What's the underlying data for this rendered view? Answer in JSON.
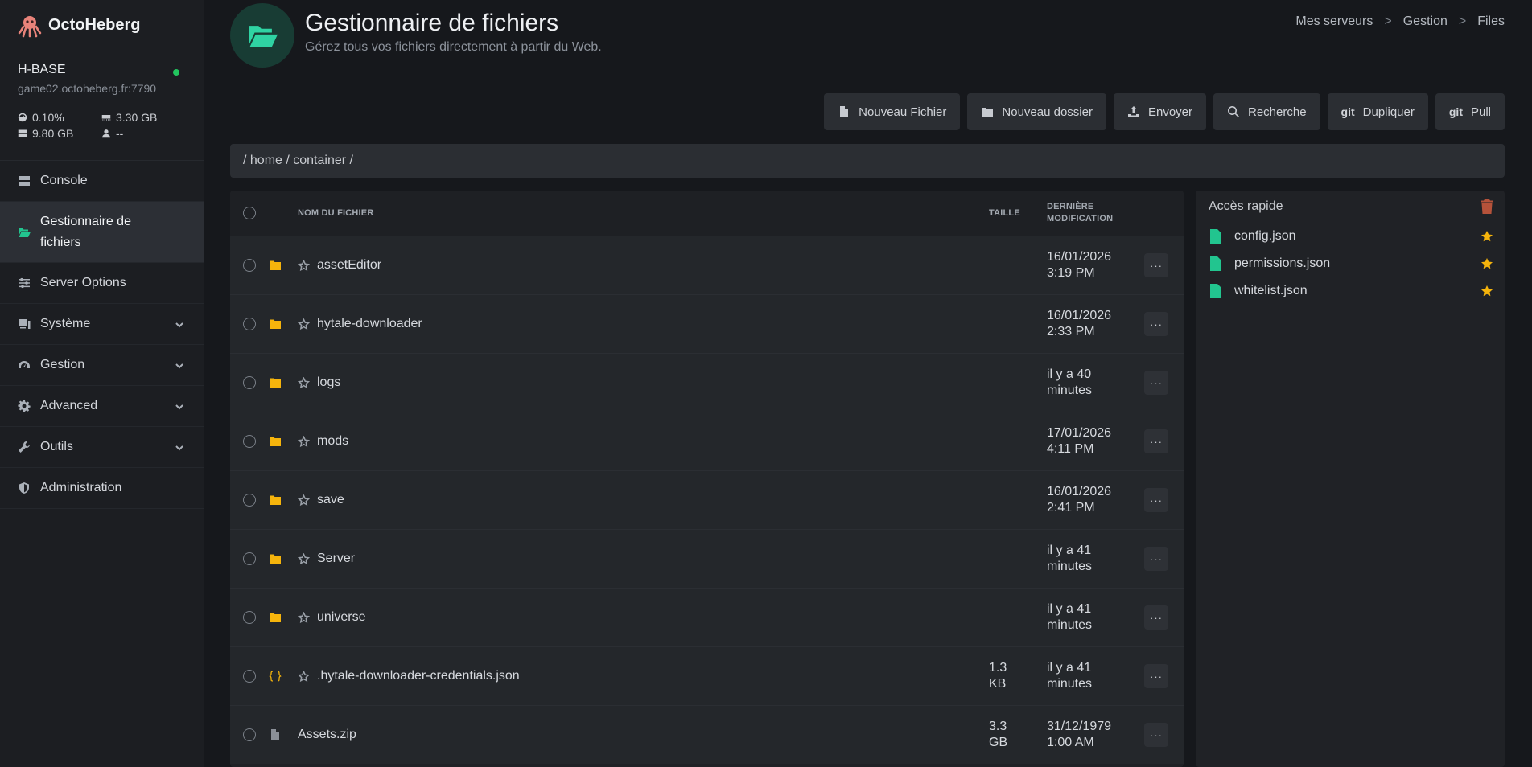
{
  "brand": {
    "name": "OctoHeberg"
  },
  "server": {
    "name": "H-BASE",
    "address": "game02.octoheberg.fr:7790",
    "cpu": "0.10%",
    "memory": "3.30 GB",
    "disk": "9.80 GB",
    "players": "--",
    "status_color": "#22c55e"
  },
  "sidebar": {
    "items": [
      {
        "label": "Console",
        "icon": "server-icon"
      },
      {
        "label": "Gestionnaire de fichiers",
        "icon": "folder-open-icon"
      },
      {
        "label": "Server Options",
        "icon": "sliders-icon"
      },
      {
        "label": "Système",
        "icon": "computer-icon"
      },
      {
        "label": "Gestion",
        "icon": "gauge-icon"
      },
      {
        "label": "Advanced",
        "icon": "gear-icon"
      },
      {
        "label": "Outils",
        "icon": "wrench-icon"
      },
      {
        "label": "Administration",
        "icon": "shield-icon"
      }
    ]
  },
  "header": {
    "title": "Gestionnaire de fichiers",
    "subtitle": "Gérez tous vos fichiers directement à partir du Web."
  },
  "breadcrumb": {
    "items": [
      "Mes serveurs",
      "Gestion",
      "Files"
    ],
    "separator": ">"
  },
  "toolbar": {
    "new_file": "Nouveau Fichier",
    "new_folder": "Nouveau dossier",
    "upload": "Envoyer",
    "search": "Recherche",
    "git_label": "git",
    "duplicate": "Dupliquer",
    "pull": "Pull"
  },
  "path": "/ home / container /",
  "table": {
    "headers": {
      "name": "NOM DU FICHIER",
      "size": "TAILLE",
      "date_line1": "DERNIÈRE",
      "date_line2": "MODIFICATION"
    },
    "more_label": "···",
    "rows": [
      {
        "name": "assetEditor",
        "type": "folder",
        "size": "",
        "size2": "",
        "date": "16/01/2026",
        "time": "3:19 PM"
      },
      {
        "name": "hytale-downloader",
        "type": "folder",
        "size": "",
        "size2": "",
        "date": "16/01/2026",
        "time": "2:33 PM"
      },
      {
        "name": "logs",
        "type": "folder",
        "size": "",
        "size2": "",
        "date": "il y a 40",
        "time": "minutes"
      },
      {
        "name": "mods",
        "type": "folder",
        "size": "",
        "size2": "",
        "date": "17/01/2026",
        "time": "4:11 PM"
      },
      {
        "name": "save",
        "type": "folder",
        "size": "",
        "size2": "",
        "date": "16/01/2026",
        "time": "2:41 PM"
      },
      {
        "name": "Server",
        "type": "folder",
        "size": "",
        "size2": "",
        "date": "il y a 41",
        "time": "minutes"
      },
      {
        "name": "universe",
        "type": "folder",
        "size": "",
        "size2": "",
        "date": "il y a 41",
        "time": "minutes"
      },
      {
        "name": ".hytale-downloader-credentials.json",
        "type": "json",
        "size": "1.3",
        "size2": "KB",
        "date": "il y a 41",
        "time": "minutes"
      },
      {
        "name": "Assets.zip",
        "type": "file",
        "size": "3.3",
        "size2": "GB",
        "date": "31/12/1979",
        "time": "1:00 AM"
      }
    ]
  },
  "quick_access": {
    "title": "Accès rapide",
    "items": [
      "config.json",
      "permissions.json",
      "whitelist.json"
    ]
  },
  "colors": {
    "accent": "#22c58f",
    "folder": "#f5b40c",
    "star": "#f5b40c",
    "trash": "#b5523a"
  }
}
